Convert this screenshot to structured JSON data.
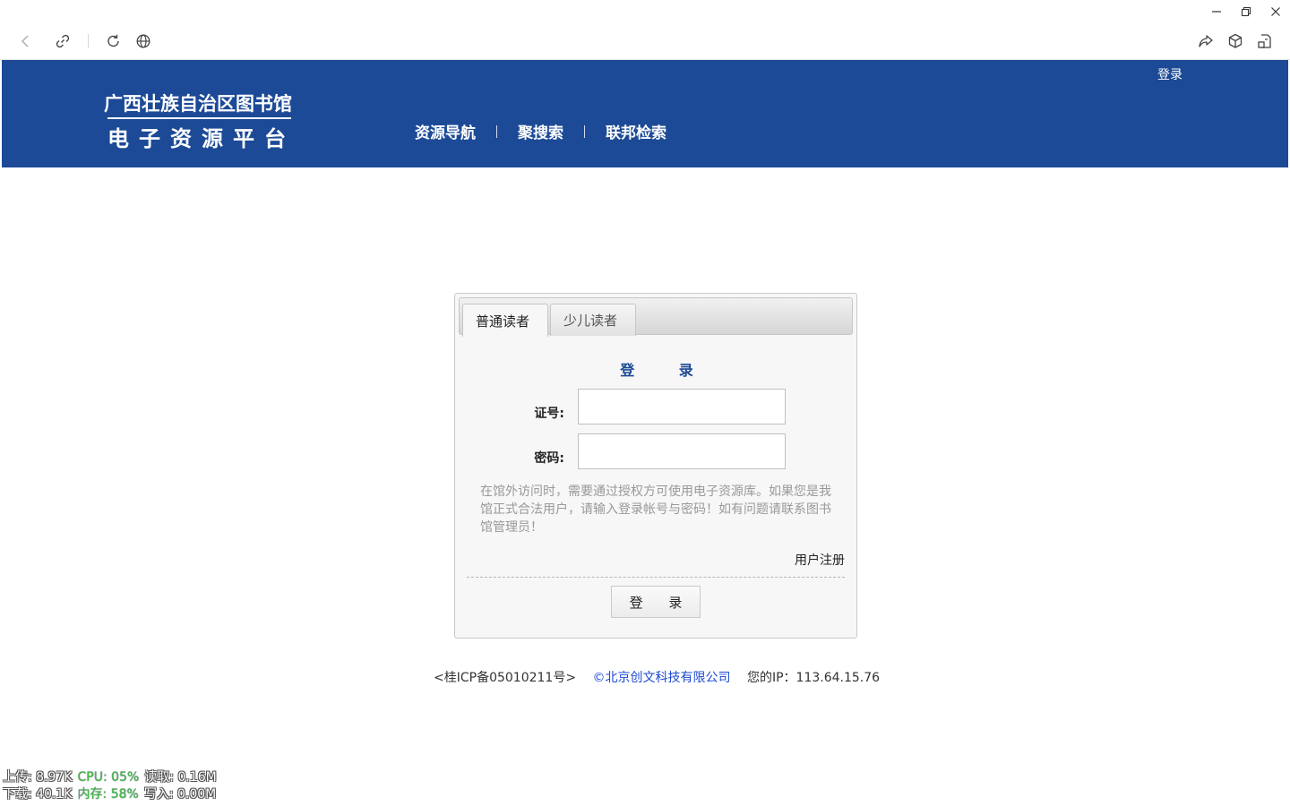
{
  "browser": {
    "controls": {
      "minimize_icon": "minimize-icon",
      "restore_icon": "restore-icon",
      "close_icon": "close-icon"
    },
    "toolbar": {
      "back_icon": "back-arrow-icon",
      "link_icon": "link-icon",
      "reload_icon": "reload-icon",
      "globe_icon": "globe-icon",
      "share_icon": "share-icon",
      "box_icon": "3d-box-icon",
      "reader_icon": "reader-mode-icon"
    }
  },
  "header": {
    "logo_title": "广西壮族自治区图书馆",
    "logo_subtitle": "电子资源平台",
    "top_login": "登录",
    "nav": [
      "资源导航",
      "聚搜索",
      "联邦检索"
    ],
    "background_color": "#1c4a96"
  },
  "login": {
    "tabs": [
      "普通读者",
      "少儿读者"
    ],
    "active_tab": "普通读者",
    "title": "登 录",
    "card_label": "证号:",
    "card_value": "",
    "password_label": "密码:",
    "password_value": "",
    "notice": "在馆外访问时，需要通过授权方可使用电子资源库。如果您是我馆正式合法用户，请输入登录帐号与密码！如有问题请联系图书馆管理员！",
    "register_link": "用户注册",
    "submit_label": "登 录"
  },
  "footer": {
    "icp": "<桂ICP备05010211号>",
    "copyright": "©北京创文科技有限公司",
    "ip_text": "您的IP：113.64.15.76"
  },
  "sysmon": {
    "upload": "上传: 8.97K",
    "cpu": "CPU: 05%",
    "read": "读取: 0.16M",
    "download": "下载: 40.1K",
    "memory": "内存: 58%",
    "write": "写入: 0.00M"
  }
}
